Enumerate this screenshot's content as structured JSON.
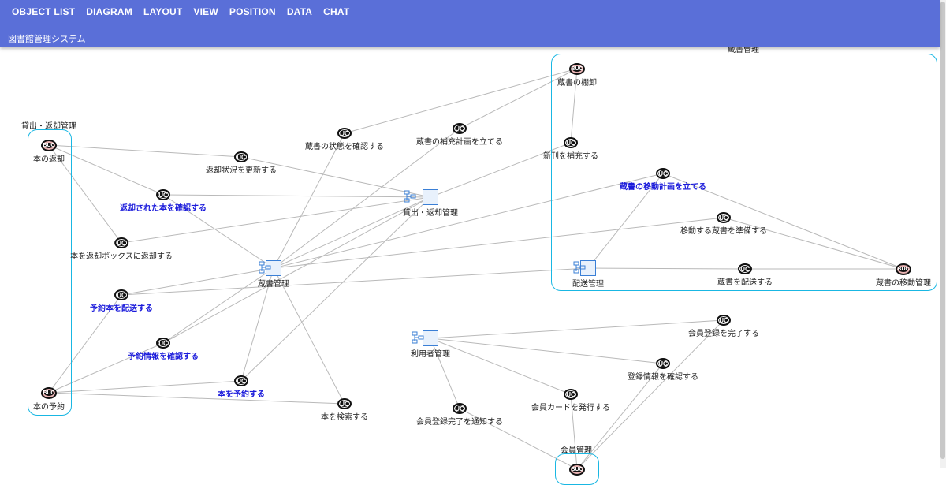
{
  "menu": [
    "OBJECT LIST",
    "DIAGRAM",
    "LAYOUT",
    "VIEW",
    "POSITION",
    "DATA",
    "CHAT"
  ],
  "app_title": "図書館管理システム",
  "groups": {
    "lending": "貸出・返却管理",
    "collection": "蔵書管理",
    "member": "会員管理"
  },
  "nodes": {
    "book_return": {
      "type": "BUC",
      "label": "本の返却"
    },
    "book_reserve": {
      "type": "BUC",
      "label": "本の予約"
    },
    "inventory": {
      "type": "BUC",
      "label": "蔵書の棚卸"
    },
    "collection_move": {
      "type": "BUC",
      "label": "蔵書の移動管理"
    },
    "member_buc": {
      "type": "BUC",
      "label": ""
    },
    "update_return": {
      "type": "UC",
      "label": "返却状況を更新する"
    },
    "confirm_returned": {
      "type": "UC",
      "label": "返却された本を確認する",
      "highlight": true
    },
    "return_box": {
      "type": "UC",
      "label": "本を返却ボックスに返却する"
    },
    "deliver_reserved": {
      "type": "UC",
      "label": "予約本を配送する",
      "highlight": true
    },
    "confirm_reserve": {
      "type": "UC",
      "label": "予約情報を確認する",
      "highlight": true
    },
    "reserve_book": {
      "type": "UC",
      "label": "本を予約する",
      "highlight": true
    },
    "search_book": {
      "type": "UC",
      "label": "本を検索する"
    },
    "check_condition": {
      "type": "UC",
      "label": "蔵書の状態を確認する"
    },
    "plan_replenish": {
      "type": "UC",
      "label": "蔵書の補充計画を立てる"
    },
    "add_new": {
      "type": "UC",
      "label": "新刊を補充する"
    },
    "plan_move": {
      "type": "UC",
      "label": "蔵書の移動計画を立てる",
      "highlight": true
    },
    "prepare_move": {
      "type": "UC",
      "label": "移動する蔵書を準備する"
    },
    "deliver_collection": {
      "type": "UC",
      "label": "蔵書を配送する"
    },
    "finish_register": {
      "type": "UC",
      "label": "会員登録を完了する"
    },
    "confirm_register": {
      "type": "UC",
      "label": "登録情報を確認する"
    },
    "issue_card": {
      "type": "UC",
      "label": "会員カードを発行する"
    },
    "notify_register": {
      "type": "UC",
      "label": "会員登録完了を通知する"
    },
    "pkg_lending": {
      "type": "PKG",
      "label": "貸出・返却管理"
    },
    "pkg_collection": {
      "type": "PKG",
      "label": "蔵書管理"
    },
    "pkg_delivery": {
      "type": "PKG",
      "label": "配送管理"
    },
    "pkg_user": {
      "type": "PKG",
      "label": "利用者管理"
    }
  },
  "colors": {
    "accent": "#5a6fd8",
    "group_border": "#19b7e3",
    "highlight_text": "#1a1adb",
    "edge": "#b9b9b9"
  }
}
